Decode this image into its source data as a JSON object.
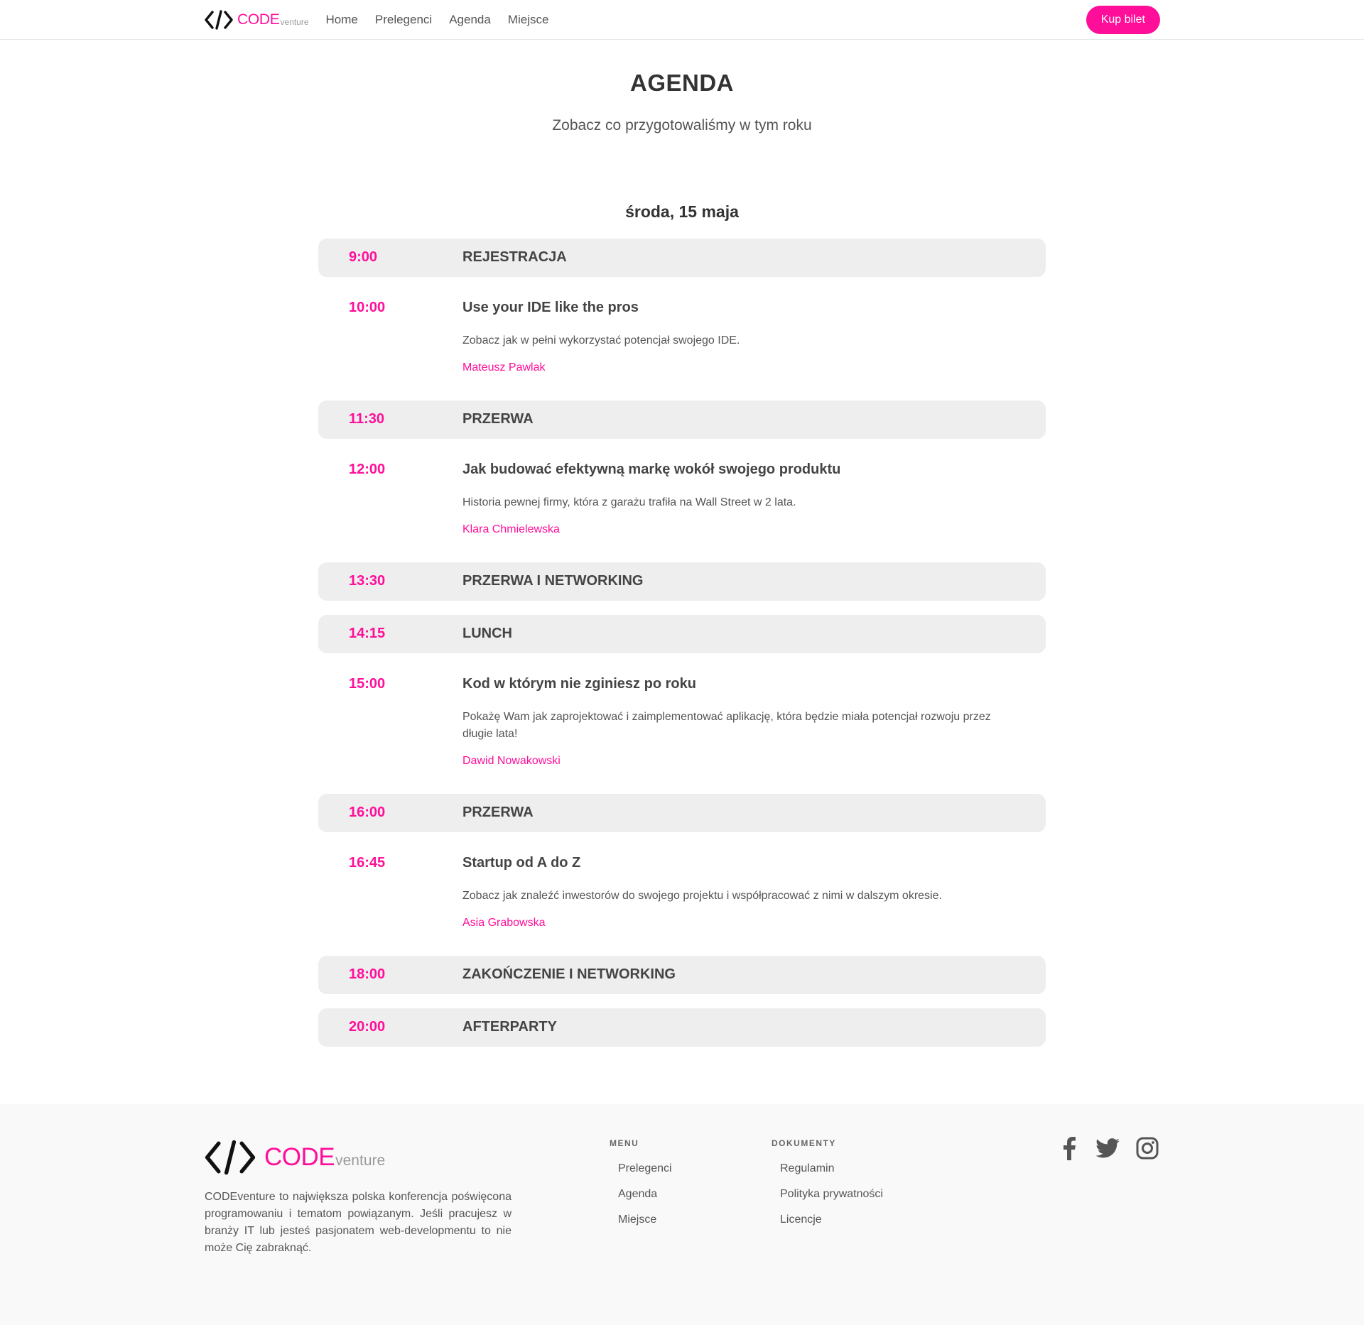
{
  "brand": {
    "code": "CODE",
    "venture": "venture"
  },
  "nav": {
    "links": [
      "Home",
      "Prelegenci",
      "Agenda",
      "Miejsce"
    ],
    "cta": "Kup bilet"
  },
  "page": {
    "title": "AGENDA",
    "subtitle": "Zobacz co przygotowaliśmy w tym roku",
    "day": "środa, 15 maja"
  },
  "agenda": [
    {
      "time": "9:00",
      "title": "REJESTRACJA"
    },
    {
      "time": "10:00",
      "title": "Use your IDE like the pros",
      "desc": "Zobacz jak w pełni wykorzystać potencjał swojego IDE.",
      "speaker": "Mateusz Pawlak"
    },
    {
      "time": "11:30",
      "title": "PRZERWA"
    },
    {
      "time": "12:00",
      "title": "Jak budować efektywną markę wokół swojego produktu",
      "desc": "Historia pewnej firmy, która z garażu trafiła na Wall Street w 2 lata.",
      "speaker": "Klara Chmielewska"
    },
    {
      "time": "13:30",
      "title": "PRZERWA I NETWORKING"
    },
    {
      "time": "14:15",
      "title": "LUNCH"
    },
    {
      "time": "15:00",
      "title": "Kod w którym nie zginiesz po roku",
      "desc": "Pokażę Wam jak zaprojektować i zaimplementować aplikację, która będzie miała potencjał rozwoju przez długie lata!",
      "speaker": "Dawid Nowakowski"
    },
    {
      "time": "16:00",
      "title": "PRZERWA"
    },
    {
      "time": "16:45",
      "title": "Startup od A do Z",
      "desc": "Zobacz jak znaleźć inwestorów do swojego projektu i współpracować z nimi w dalszym okresie.",
      "speaker": "Asia Grabowska"
    },
    {
      "time": "18:00",
      "title": "ZAKOŃCZENIE I NETWORKING"
    },
    {
      "time": "20:00",
      "title": "AFTERPARTY"
    }
  ],
  "footer": {
    "about": "CODEventure to największa polska konferencja poświęcona programowaniu i tematom powiązanym. Jeśli pracujesz w branży IT lub jesteś pasjonatem web-developmentu to nie może Cię zabraknąć.",
    "menu_title": "MENU",
    "menu": [
      "Prelegenci",
      "Agenda",
      "Miejsce"
    ],
    "docs_title": "DOKUMENTY",
    "docs": [
      "Regulamin",
      "Polityka prywatności",
      "Licencje"
    ],
    "social": [
      "facebook-icon",
      "twitter-icon",
      "instagram-icon"
    ]
  },
  "colors": {
    "accent": "#ff0e9a",
    "break_bg": "#eeeeee",
    "footer_bg": "#f9f9f9"
  }
}
